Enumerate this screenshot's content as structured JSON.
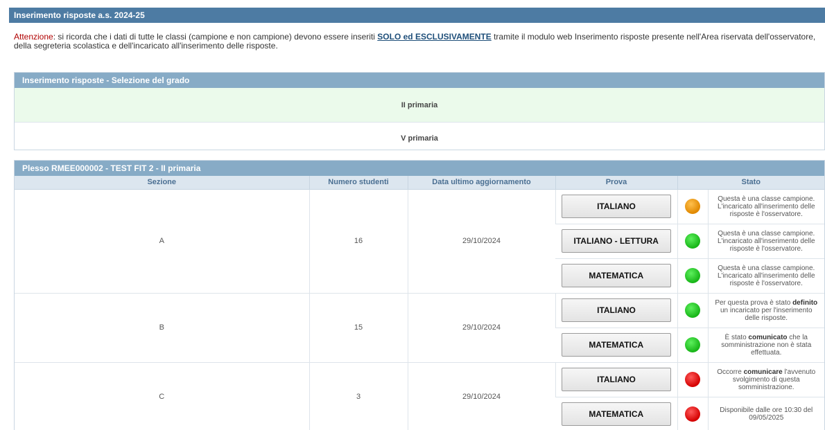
{
  "header": {
    "title": "Inserimento risposte a.s. 2024-25"
  },
  "notice": {
    "warn_label": "Attenzione",
    "text_before": ": si ricorda che i dati di tutte le classi (campione e non campione) devono essere inseriti ",
    "emphasis": "SOLO ed ESCLUSIVAMENTE",
    "text_after": " tramite il modulo web Inserimento risposte presente nell'Area riservata dell'osservatore, della segreteria scolastica e dell'incaricato all'inserimento delle risposte."
  },
  "grade_panel": {
    "title": "Inserimento risposte - Selezione del grado",
    "grades": [
      "II primaria",
      "V primaria"
    ]
  },
  "results_panel": {
    "title": "Plesso RMEE000002 - TEST FIT 2 - II primaria",
    "columns": {
      "sezione": "Sezione",
      "numero": "Numero studenti",
      "data": "Data ultimo aggiornamento",
      "prova": "Prova",
      "stato": "Stato"
    },
    "sections": [
      {
        "name": "A",
        "students": "16",
        "date": "29/10/2024",
        "tests": [
          {
            "label": "ITALIANO",
            "status": "orange",
            "pre": "Questa è una classe campione. L'incaricato all'inserimento delle risposte è l'osservatore.",
            "bold": "",
            "post": ""
          },
          {
            "label": "ITALIANO - LETTURA",
            "status": "green",
            "pre": "Questa è una classe campione. L'incaricato all'inserimento delle risposte è l'osservatore.",
            "bold": "",
            "post": ""
          },
          {
            "label": "MATEMATICA",
            "status": "green",
            "pre": "Questa è una classe campione. L'incaricato all'inserimento delle risposte è l'osservatore.",
            "bold": "",
            "post": ""
          }
        ]
      },
      {
        "name": "B",
        "students": "15",
        "date": "29/10/2024",
        "tests": [
          {
            "label": "ITALIANO",
            "status": "green",
            "pre": "Per questa prova è stato ",
            "bold": "definito",
            "post": " un incaricato per l'inserimento delle risposte."
          },
          {
            "label": "MATEMATICA",
            "status": "green",
            "pre": "È stato ",
            "bold": "comunicato",
            "post": " che la somministrazione non è stata effettuata."
          }
        ]
      },
      {
        "name": "C",
        "students": "3",
        "date": "29/10/2024",
        "tests": [
          {
            "label": "ITALIANO",
            "status": "red",
            "pre": "Occorre ",
            "bold": "comunicare",
            "post": " l'avvenuto svolgimento di questa somministrazione."
          },
          {
            "label": "MATEMATICA",
            "status": "red",
            "pre": "Disponibile dalle ore 10:30 del 09/05/2025",
            "bold": "",
            "post": ""
          }
        ]
      }
    ]
  }
}
